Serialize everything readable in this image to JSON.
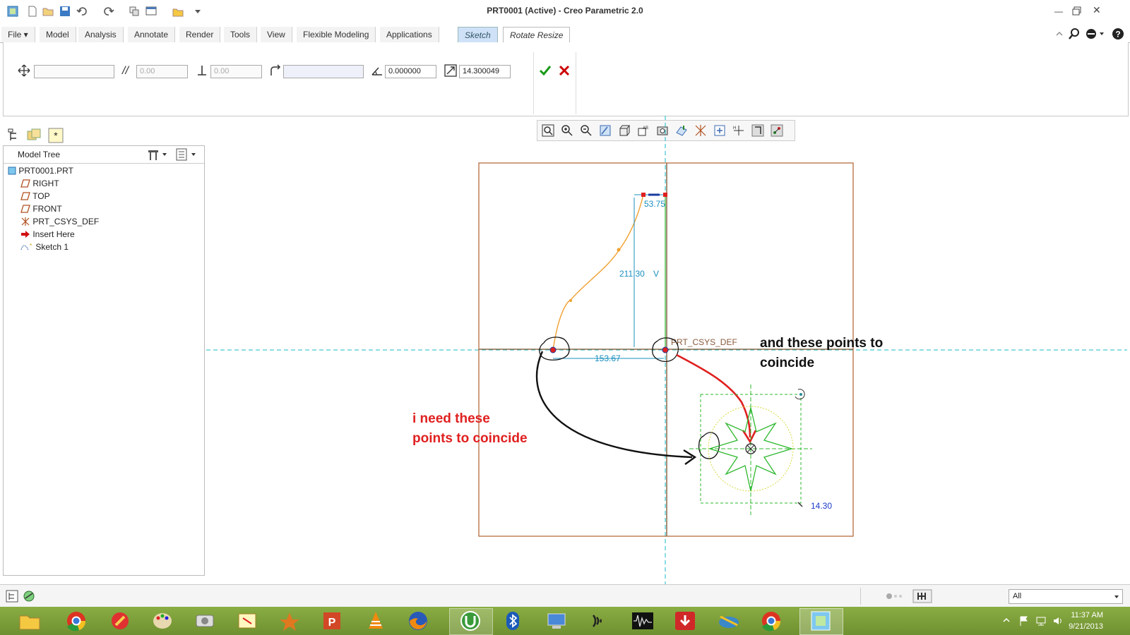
{
  "window": {
    "title": "PRT0001 (Active) - Creo Parametric 2.0",
    "controls": [
      "minimize-icon",
      "restore-icon",
      "close-icon"
    ]
  },
  "ribbon": {
    "tabs": [
      {
        "label": "File ▾"
      },
      {
        "label": "Model"
      },
      {
        "label": "Analysis"
      },
      {
        "label": "Annotate"
      },
      {
        "label": "Render"
      },
      {
        "label": "Tools"
      },
      {
        "label": "View"
      },
      {
        "label": "Flexible Modeling"
      },
      {
        "label": "Applications"
      },
      {
        "label": "Sketch"
      },
      {
        "label": "Rotate Resize"
      }
    ]
  },
  "dashboard": {
    "move_value": "",
    "horizontal_value": "0.00",
    "vertical_value": "0.00",
    "reference_value": "",
    "rotate_angle": "0.000000",
    "scale_value": "14.300049"
  },
  "model_tree": {
    "title": "Model Tree",
    "items": [
      {
        "label": "PRT0001.PRT"
      },
      {
        "label": "RIGHT"
      },
      {
        "label": "TOP"
      },
      {
        "label": "FRONT"
      },
      {
        "label": "PRT_CSYS_DEF"
      },
      {
        "label": "Insert Here"
      },
      {
        "label": "Sketch 1"
      }
    ]
  },
  "sketch": {
    "dim_top": "53.75",
    "dim_vertical": "211.30",
    "dim_vertical_tag": "V",
    "dim_horizontal": "153.67",
    "csys_label": "PRT_CSYS_DEF",
    "scale_label": "14.30"
  },
  "annotations": {
    "red_line1": "i need these",
    "red_line2": "points to coincide",
    "black_line1": "and these points to",
    "black_line2": "coincide"
  },
  "statusbar": {
    "filter_value": "All"
  },
  "taskbar": {
    "time": "11:37 AM",
    "date": "9/21/2013"
  },
  "colors": {
    "sketch_orange": "#f0a030",
    "dimension_blue": "#1a8fbf",
    "star_green": "#2db82d",
    "annotation_red": "#e02020",
    "taskbar_green": "#7a9a3a"
  }
}
